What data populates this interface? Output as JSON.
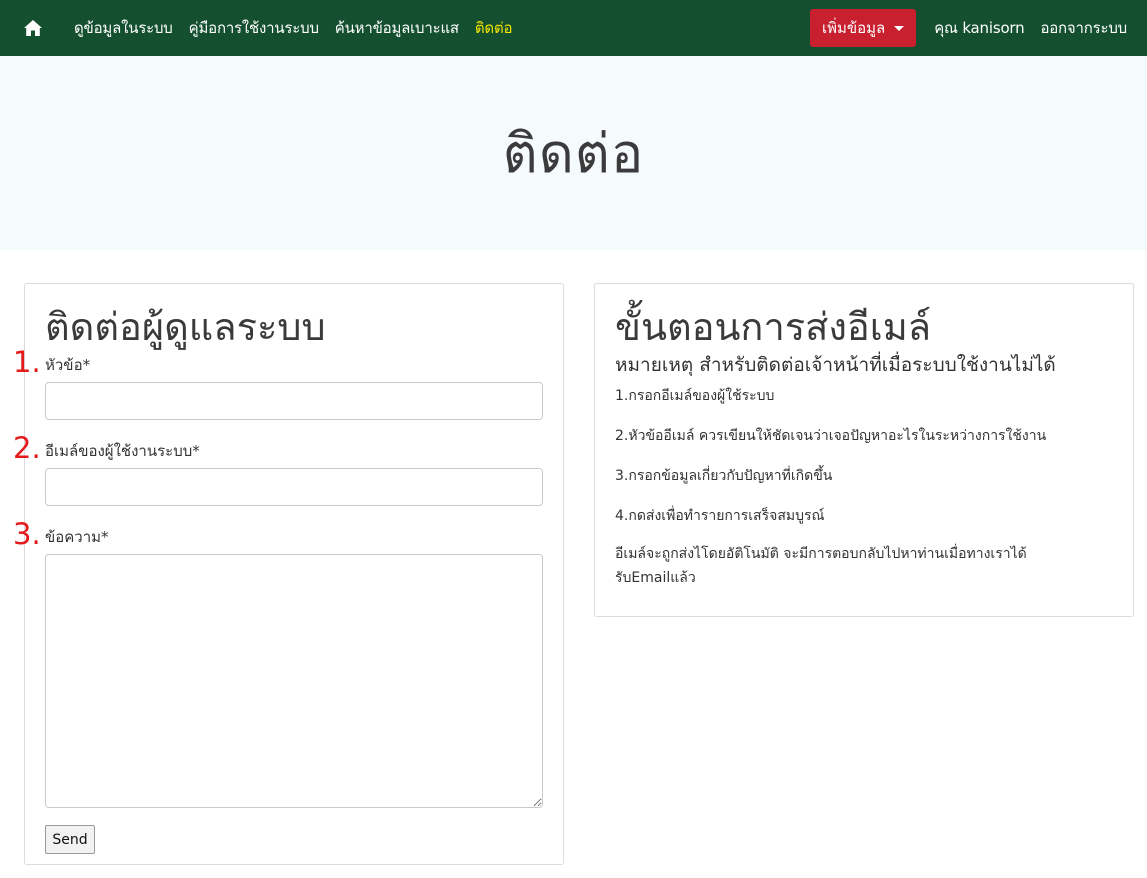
{
  "navbar": {
    "home_icon": "home-icon",
    "links": [
      "ดูข้อมูลในระบบ",
      "คู่มือการใช้งานระบบ",
      "ค้นหาข้อมูลเบาะแส",
      "ติดต่อ"
    ],
    "add_button": "เพิ่มข้อมูล",
    "user": "คุณ kanisorn",
    "logout": "ออกจากระบบ",
    "colors": {
      "background": "#14502f",
      "active_link": "#f5e400",
      "add_button": "#c8202f"
    }
  },
  "jumbotron": {
    "title": "ติดต่อ"
  },
  "contact_form": {
    "title": "ติดต่อผู้ดูแลระบบ",
    "fields": [
      {
        "number": "1.",
        "label": "หัวข้อ*",
        "value": ""
      },
      {
        "number": "2.",
        "label": "อีเมล์ของผู้ใช้งานระบบ*",
        "value": ""
      },
      {
        "number": "3.",
        "label": "ข้อความ*",
        "value": ""
      }
    ],
    "submit_label": "Send"
  },
  "email_steps": {
    "title": "ขั้นตอนการส่งอีเมล์",
    "note": "หมายเหตุ สำหรับติดต่อเจ้าหน้าที่เมื่อระบบใช้งานไม่ได้",
    "steps": [
      "1.กรอกอีเมล์ของผู้ใช้ระบบ",
      "2.หัวข้ออีเมล์ ควรเขียนให้ชัดเจนว่าเจอปัญหาอะไรในระหว่างการใช้งาน",
      "3.กรอกข้อมูลเกี่ยวกับปัญหาที่เกิดขึ้น",
      "4.กดส่งเพื่อทำรายการเสร็จสมบูรณ์"
    ],
    "final_note": "อีเมล์จะถูกส่งไโดยอัติโนมัติ จะมีการตอบกลับไปหาท่านเมื่อทางเราได้รับEmailแล้ว"
  }
}
